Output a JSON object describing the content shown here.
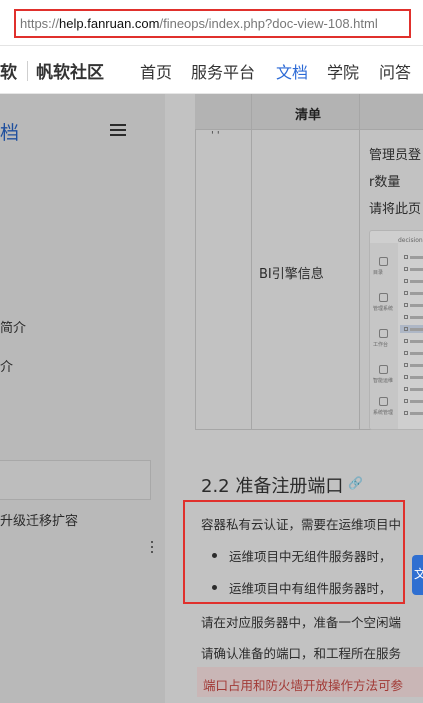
{
  "browser": {
    "url_scheme": "https://",
    "url_host": "help.fanruan.com",
    "url_path": "/fineops/index.php?doc-view-108.html"
  },
  "nav": {
    "logo_fragment": "软",
    "community": "帆软社区",
    "items": [
      "首页",
      "服务平台",
      "文档",
      "学院",
      "问答"
    ],
    "active_index": 2
  },
  "sidebar": {
    "title_fragment": "档",
    "items": [
      "简介",
      "介",
      "升级迁移扩容"
    ]
  },
  "table": {
    "header": "清单",
    "tick": "' '",
    "row_label": "BI引擎信息",
    "right_lines": [
      "管理员登",
      "r数量",
      "请将此页"
    ]
  },
  "thumbnail": {
    "top_text": "decision",
    "side_labels": [
      "目录",
      "管理系统",
      "工作台",
      "智能运维",
      "系统管理"
    ]
  },
  "section": {
    "title": "2.2 准备注册端口",
    "para1": "容器私有云认证，需要在运维项目中",
    "bullets": [
      "运维项目中无组件服务器时，",
      "运维项目中有组件服务器时，"
    ],
    "para2": "请在对应服务器中，准备一个空闲端",
    "para3": "请确认准备的端口，和工程所在服务",
    "warning": "端口占用和防火墙开放操作方法可参"
  },
  "float_button": {
    "label": "文"
  },
  "colors": {
    "highlight_border": "#e0302c",
    "nav_active": "#2c6ad6",
    "warning_text": "#a23a36"
  }
}
